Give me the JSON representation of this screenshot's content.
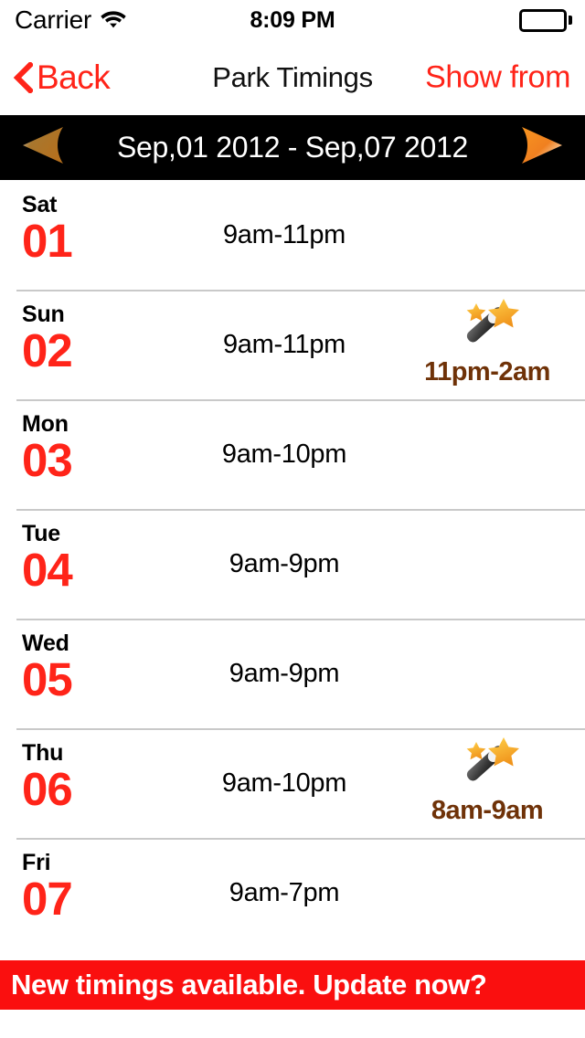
{
  "status_bar": {
    "carrier": "Carrier",
    "wifi_icon": "wifi-icon",
    "time": "8:09 PM",
    "battery_icon": "battery-full-icon"
  },
  "nav_bar": {
    "back_icon": "chevron-left-icon",
    "back_label": "Back",
    "title": "Park Timings",
    "action_label": "Show from"
  },
  "date_range": {
    "prev_icon": "triangle-left-icon",
    "label": "Sep,01 2012 - Sep,07 2012",
    "next_icon": "triangle-right-icon"
  },
  "colors": {
    "accent_red": "#FF2419",
    "banner_red": "#FA0F0F",
    "magic_brown": "#6F3208",
    "bar_black": "#000000",
    "arrow_orange": "#F08020",
    "arrow_orange_dim": "#B5701E",
    "separator": "#C9C9C9"
  },
  "schedule": {
    "rows": [
      {
        "dow": "Sat",
        "day": "01",
        "hours": "9am-11pm",
        "magic_icon": "",
        "magic_hours": ""
      },
      {
        "dow": "Sun",
        "day": "02",
        "hours": "9am-11pm",
        "magic_icon": "magic-wand-icon",
        "magic_hours": "11pm-2am"
      },
      {
        "dow": "Mon",
        "day": "03",
        "hours": "9am-10pm",
        "magic_icon": "",
        "magic_hours": ""
      },
      {
        "dow": "Tue",
        "day": "04",
        "hours": "9am-9pm",
        "magic_icon": "",
        "magic_hours": ""
      },
      {
        "dow": "Wed",
        "day": "05",
        "hours": "9am-9pm",
        "magic_icon": "",
        "magic_hours": ""
      },
      {
        "dow": "Thu",
        "day": "06",
        "hours": "9am-10pm",
        "magic_icon": "magic-wand-icon",
        "magic_hours": "8am-9am"
      },
      {
        "dow": "Fri",
        "day": "07",
        "hours": "9am-7pm",
        "magic_icon": "",
        "magic_hours": ""
      }
    ]
  },
  "banner": {
    "text": "New timings available. Update now?"
  }
}
